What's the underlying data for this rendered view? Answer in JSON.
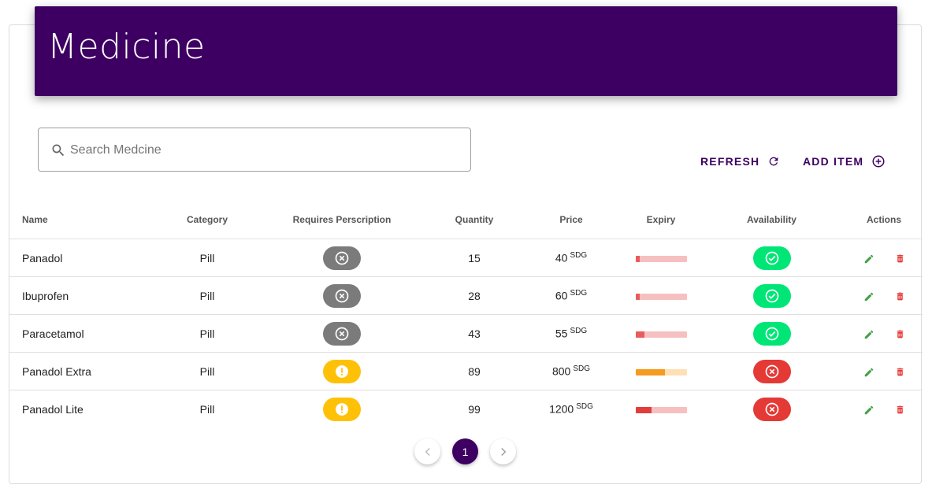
{
  "header": {
    "title": "Medicine"
  },
  "search": {
    "placeholder": "Search Medcine",
    "value": ""
  },
  "toolbar": {
    "refresh_label": "REFRESH",
    "add_label": "ADD ITEM"
  },
  "columns": [
    "Name",
    "Category",
    "Requires Perscription",
    "Quantity",
    "Price",
    "Expiry",
    "Availability",
    "Actions"
  ],
  "rows": [
    {
      "name": "Panadol",
      "category": "Pill",
      "requires_prescription": "no",
      "quantity": "15",
      "price": "40",
      "unit": "SDG",
      "expiry_fraction": 0.08,
      "expiry_color": "#e85c5c",
      "expiry_track": "#f6c0c0",
      "available": "yes"
    },
    {
      "name": "Ibuprofen",
      "category": "Pill",
      "requires_prescription": "no",
      "quantity": "28",
      "price": "60",
      "unit": "SDG",
      "expiry_fraction": 0.08,
      "expiry_color": "#e85c5c",
      "expiry_track": "#f6c0c0",
      "available": "yes"
    },
    {
      "name": "Paracetamol",
      "category": "Pill",
      "requires_prescription": "no",
      "quantity": "43",
      "price": "55",
      "unit": "SDG",
      "expiry_fraction": 0.18,
      "expiry_color": "#e85c5c",
      "expiry_track": "#f6c0c0",
      "available": "yes"
    },
    {
      "name": "Panadol Extra",
      "category": "Pill",
      "requires_prescription": "warning",
      "quantity": "89",
      "price": "800",
      "unit": "SDG",
      "expiry_fraction": 0.58,
      "expiry_color": "#f59b20",
      "expiry_track": "#fde0b4",
      "available": "no"
    },
    {
      "name": "Panadol Lite",
      "category": "Pill",
      "requires_prescription": "warning",
      "quantity": "99",
      "price": "1200",
      "unit": "SDG",
      "expiry_fraction": 0.32,
      "expiry_color": "#e23d3d",
      "expiry_track": "#f6c0c0",
      "available": "no"
    }
  ],
  "pagination": {
    "current": "1"
  },
  "colors": {
    "brand": "#3d0062",
    "available": "#00e676",
    "unavailable": "#e53935",
    "no_prescription": "#7b7b7b",
    "warning": "#ffc107",
    "edit": "#43a047",
    "delete": "#e53935"
  },
  "icons": {
    "search": "search-icon",
    "refresh": "refresh-icon",
    "add": "add-circle-icon",
    "no_prescription": "cancel-circle-icon",
    "warning": "exclamation-icon",
    "available": "check-circle-icon",
    "unavailable": "cancel-circle-icon",
    "edit": "pencil-icon",
    "delete": "trash-icon",
    "prev": "chevron-left-icon",
    "next": "chevron-right-icon"
  }
}
